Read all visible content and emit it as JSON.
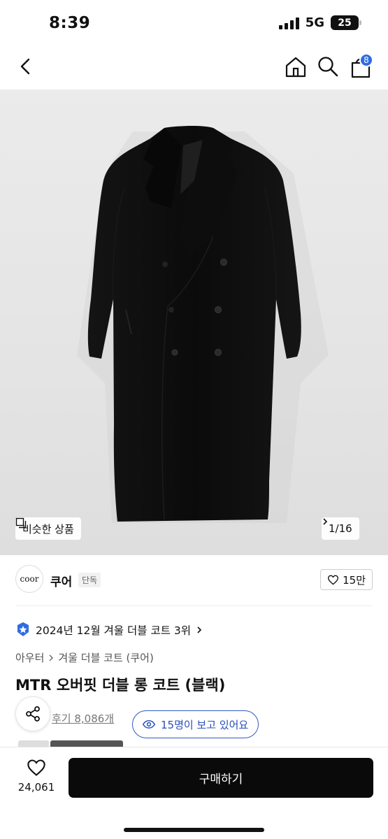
{
  "status": {
    "time": "8:39",
    "network": "5G",
    "battery": "25"
  },
  "nav": {
    "cart_count": "8"
  },
  "gallery": {
    "similar_label": "비슷한 상품",
    "counter": "1/16"
  },
  "brand": {
    "logo_text": "coor",
    "name": "쿠어",
    "tag": "단독",
    "likes": "15만"
  },
  "product": {
    "ranking": "2024년 12월 겨울 더블 코트 3위",
    "breadcrumb": [
      "아우터",
      "겨울 더블 코트 (쿠어)"
    ],
    "title": "MTR 오버핏 더블 롱 코트 (블랙)",
    "reviews": "후기 8,086개",
    "viewers": "15명이 보고 있어요"
  },
  "bottom": {
    "wish_count": "24,061",
    "buy_label": "구매하기"
  },
  "colors": {
    "accent_blue": "#2f6ce5",
    "viewer_blue": "#3358c4",
    "buy_button": "#0a0a0a"
  }
}
